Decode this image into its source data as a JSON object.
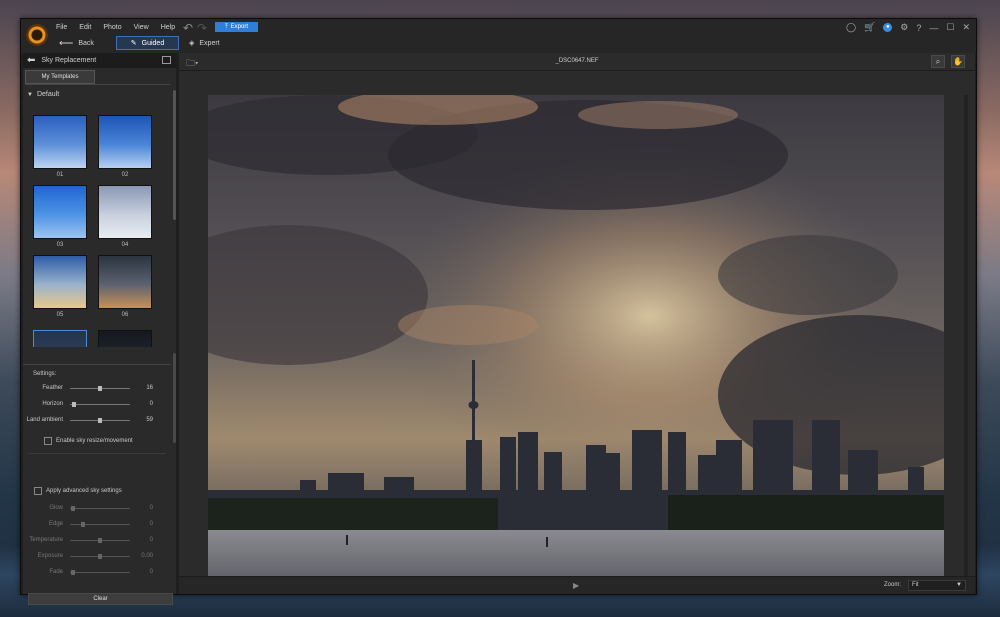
{
  "menu": [
    "File",
    "Edit",
    "Photo",
    "View",
    "Help"
  ],
  "toolbar": {
    "export_label": "Export",
    "back_label": "Back",
    "guided_label": "Guided",
    "expert_label": "Expert"
  },
  "panel": {
    "title": "Sky Replacement",
    "tab": "My Templates",
    "group": "Default",
    "templates": [
      {
        "label": "01",
        "colors": [
          "#2a5fbf",
          "#5e90d9",
          "#bcd4f0"
        ]
      },
      {
        "label": "02",
        "colors": [
          "#1c55b6",
          "#4a85d8",
          "#b6cff0"
        ]
      },
      {
        "label": "03",
        "colors": [
          "#1e66d0",
          "#4e93e6",
          "#9cc4ef"
        ]
      },
      {
        "label": "04",
        "colors": [
          "#8a98b4",
          "#c8d0de",
          "#e8ecf2"
        ]
      },
      {
        "label": "05",
        "colors": [
          "#2d5ca8",
          "#9ab3cc",
          "#e8c88a"
        ]
      },
      {
        "label": "06",
        "colors": [
          "#2c3440",
          "#5c6270",
          "#c89058"
        ]
      }
    ],
    "settings_title": "Settings:",
    "settings": [
      {
        "label": "Feather",
        "value": "16",
        "pos": 0.5
      },
      {
        "label": "Horizon",
        "value": "0",
        "pos": 0.03
      },
      {
        "label": "Land ambient",
        "value": "59",
        "pos": 0.5
      }
    ],
    "enable_resize": "Enable sky resize/movement",
    "advanced": "Apply advanced sky settings",
    "advanced_settings": [
      {
        "label": "Glow",
        "value": "0",
        "pos": 0.02
      },
      {
        "label": "Edge",
        "value": "0",
        "pos": 0.2
      },
      {
        "label": "Temperature",
        "value": "0",
        "pos": 0.5
      },
      {
        "label": "Exposure",
        "value": "0.00",
        "pos": 0.5
      },
      {
        "label": "Fade",
        "value": "0",
        "pos": 0.02
      }
    ],
    "clear_label": "Clear"
  },
  "canvas": {
    "filename": "_DSC0647.NEF"
  },
  "zoom": {
    "label": "Zoom:",
    "value": "Fit"
  },
  "colors": {
    "accent": "#2f7fd8",
    "panel_bg": "#2a2a2a",
    "bg": "#1f1f1f"
  }
}
